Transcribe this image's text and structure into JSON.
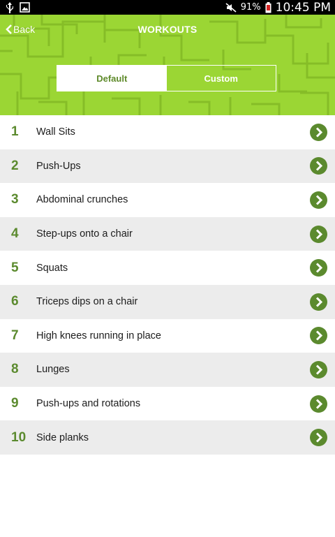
{
  "status_bar": {
    "left_icons": [
      "usb-icon",
      "image-notification-icon"
    ],
    "right_icons": [
      "mute-icon",
      "battery-icon"
    ],
    "battery": "91%",
    "time": "10:45 PM"
  },
  "header": {
    "back_label": "Back",
    "title": "WORKOUTS",
    "tabs": [
      {
        "label": "Default",
        "active": true
      },
      {
        "label": "Custom",
        "active": false
      }
    ],
    "background_color": "#9bd634"
  },
  "workouts": [
    {
      "number": "1",
      "name": "Wall Sits"
    },
    {
      "number": "2",
      "name": "Push-Ups"
    },
    {
      "number": "3",
      "name": "Abdominal crunches"
    },
    {
      "number": "4",
      "name": "Step-ups onto a chair"
    },
    {
      "number": "5",
      "name": "Squats"
    },
    {
      "number": "6",
      "name": "Triceps dips on a chair"
    },
    {
      "number": "7",
      "name": "High knees running in place"
    },
    {
      "number": "8",
      "name": "Lunges"
    },
    {
      "number": "9",
      "name": "Push-ups and rotations"
    },
    {
      "number": "10",
      "name": "Side planks"
    }
  ],
  "colors": {
    "accent_green": "#5b8a2e",
    "row_alt": "#ececec"
  }
}
